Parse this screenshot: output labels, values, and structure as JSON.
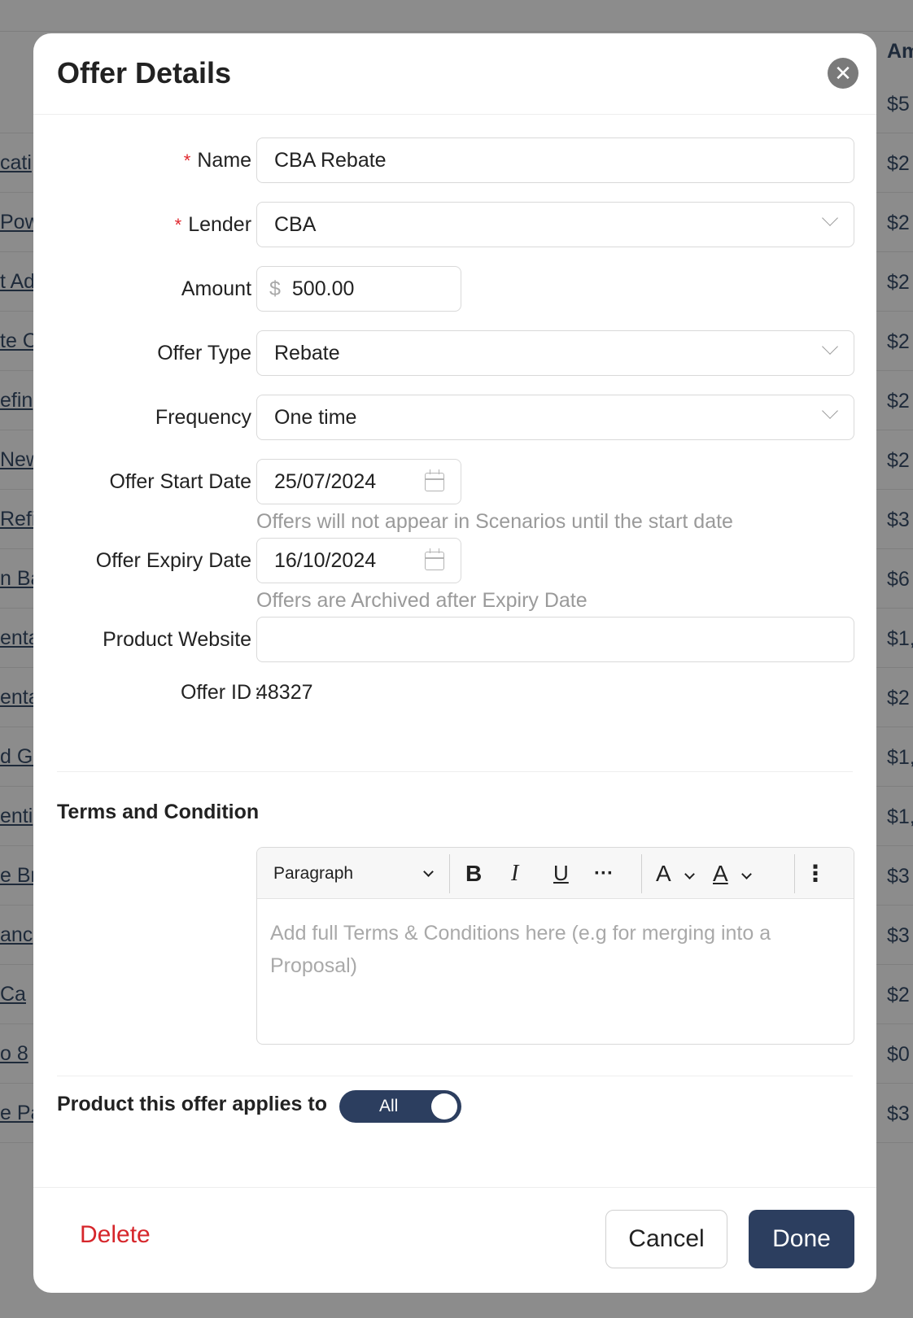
{
  "background": {
    "header_right": "Am",
    "left_column": [
      "cati",
      "Pow",
      "t Ad",
      "te C",
      "efin",
      "New",
      "Refi",
      "n Ba",
      "enta",
      "enta",
      "d Gr",
      "enti",
      "e Br",
      "anc",
      " Ca",
      "o 8",
      "e Pa"
    ],
    "right_column": [
      "$5",
      "$2",
      "$2",
      "$2",
      "$2",
      "$2",
      "$2",
      "$3",
      "$6",
      "$1,",
      "$2",
      "$1,",
      "$1,",
      "$3",
      "$3",
      "$2",
      "$0",
      "$3"
    ]
  },
  "modal": {
    "title": "Offer Details",
    "close_symbol": "✕",
    "fields": {
      "name": {
        "label": "Name",
        "value": "CBA Rebate",
        "required": "*"
      },
      "lender": {
        "label": "Lender",
        "value": "CBA",
        "required": "*"
      },
      "amount": {
        "label": "Amount",
        "prefix": "$",
        "value": "500.00"
      },
      "offer_type": {
        "label": "Offer Type",
        "value": "Rebate"
      },
      "frequency": {
        "label": "Frequency",
        "value": "One time"
      },
      "start_date": {
        "label": "Offer Start Date",
        "value": "25/07/2024",
        "helper": "Offers will not appear in Scenarios until the start date"
      },
      "expiry_date": {
        "label": "Offer Expiry Date",
        "value": "16/10/2024",
        "helper": "Offers are Archived after Expiry Date"
      },
      "website": {
        "label": "Product Website",
        "value": ""
      },
      "offer_id": {
        "label": "Offer ID",
        "value": "48327"
      }
    },
    "colon": ":",
    "terms": {
      "title": "Terms and Condition",
      "toolbar": {
        "paragraph": "Paragraph",
        "bold": "B",
        "italic": "I",
        "underline": "U",
        "more": "···",
        "font_size": "A",
        "font_color": "A",
        "overflow": "⋮"
      },
      "placeholder": "Add full Terms & Conditions here (e.g for merging into a Proposal)"
    },
    "product": {
      "label": "Product this offer applies to",
      "toggle_label": "All"
    },
    "footer": {
      "delete": "Delete",
      "cancel": "Cancel",
      "done": "Done"
    }
  }
}
